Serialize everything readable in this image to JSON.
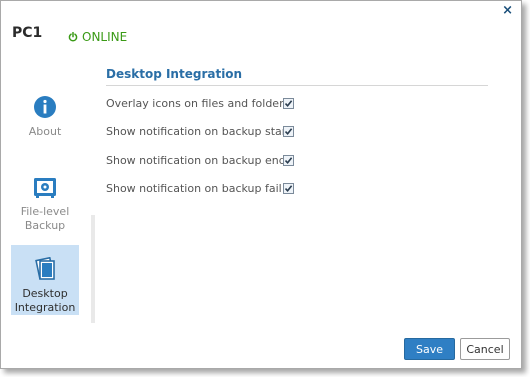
{
  "header": {
    "title": "PC1",
    "status": "ONLINE",
    "close_glyph": "×"
  },
  "sidebar": {
    "items": [
      {
        "label": "About",
        "icon": "info-icon",
        "active": false
      },
      {
        "label": "File-level Backup",
        "icon": "safe-icon",
        "active": false
      },
      {
        "label": "Desktop Integration",
        "icon": "stacked-pages-icon",
        "active": true
      }
    ]
  },
  "main": {
    "section_title": "Desktop Integration",
    "options": [
      {
        "label": "Overlay icons on files and folders:",
        "checked": true
      },
      {
        "label": "Show notification on backup start:",
        "checked": true
      },
      {
        "label": "Show notification on backup end:",
        "checked": true
      },
      {
        "label": "Show notification on backup fail:",
        "checked": true
      }
    ]
  },
  "footer": {
    "save_label": "Save",
    "cancel_label": "Cancel"
  },
  "colors": {
    "accent": "#2f7fc4",
    "status_online": "#3a9a16",
    "active_nav_bg": "#c9e0f5"
  }
}
